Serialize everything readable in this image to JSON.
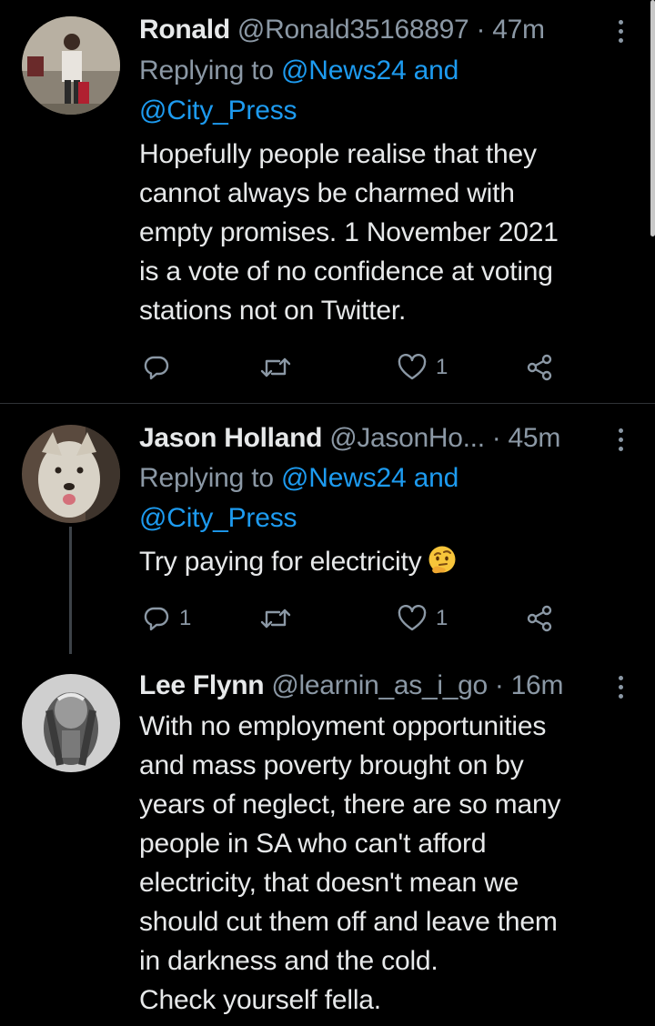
{
  "tweets": [
    {
      "display_name": "Ronald",
      "handle": "@Ronald35168897",
      "dot": "·",
      "time": "47m",
      "replying_prefix": "Replying to",
      "replying_mention_1": "@News24",
      "replying_and": "and",
      "replying_mention_2": "@City_Press",
      "body_lines": [
        "Hopefully people realise that they",
        "cannot always be charmed with",
        "empty promises. 1 November 2021",
        "is a vote of no confidence at voting",
        "stations not on Twitter."
      ],
      "reply_count": "",
      "retweet_count": "",
      "like_count": "1"
    },
    {
      "display_name": "Jason Holland",
      "handle": "@JasonHo...",
      "dot": "·",
      "time": "45m",
      "replying_prefix": "Replying to",
      "replying_mention_1": "@News24",
      "replying_and": "and",
      "replying_mention_2": "@City_Press",
      "body_lines": [
        "Try paying for electricity"
      ],
      "emoji_name": "thinking-face-icon",
      "reply_count": "1",
      "retweet_count": "",
      "like_count": "1"
    },
    {
      "display_name": "Lee Flynn",
      "handle": "@learnin_as_i_go",
      "dot": "·",
      "time": "16m",
      "body_lines": [
        "With no employment opportunities",
        "and mass poverty brought on by",
        "years of neglect, there are so many",
        "people in SA who can't afford",
        "electricity, that doesn't mean we",
        "should cut them off and leave them",
        "in darkness and the cold.",
        "Check yourself fella."
      ]
    }
  ],
  "icons": {
    "reply": "reply-icon",
    "retweet": "retweet-icon",
    "like": "heart-icon",
    "share": "share-icon",
    "more": "more-options-icon"
  },
  "colors": {
    "background": "#000000",
    "text": "#e7e9ea",
    "secondary": "#8b98a5",
    "accent": "#1d9bf0",
    "divider": "#2f3336"
  }
}
